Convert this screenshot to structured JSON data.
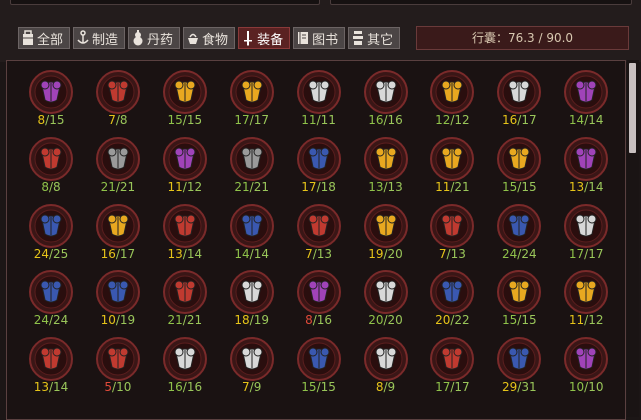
{
  "tabs": [
    {
      "label": "全部",
      "icon": "bag-icon",
      "active": false
    },
    {
      "label": "制造",
      "icon": "anvil-icon",
      "active": false
    },
    {
      "label": "丹药",
      "icon": "gourd-icon",
      "active": false
    },
    {
      "label": "食物",
      "icon": "food-icon",
      "active": false
    },
    {
      "label": "装备",
      "icon": "sword-icon",
      "active": true
    },
    {
      "label": "图书",
      "icon": "book-icon",
      "active": false
    },
    {
      "label": "其它",
      "icon": "misc-icon",
      "active": false
    }
  ],
  "capacity": "行囊：76.3 / 90.0",
  "colors": {
    "purple": "#a043b8",
    "red": "#c03a30",
    "gold": "#e8a820",
    "white": "#d8d8d8",
    "gray": "#9a9a9a",
    "blue": "#3a58b0"
  },
  "items": [
    {
      "cur": "8",
      "max": "15",
      "color": "purple",
      "state": "low"
    },
    {
      "cur": "7",
      "max": "8",
      "color": "red",
      "state": "low"
    },
    {
      "cur": "15",
      "max": "15",
      "color": "gold",
      "state": "ok"
    },
    {
      "cur": "17",
      "max": "17",
      "color": "gold",
      "state": "ok"
    },
    {
      "cur": "11",
      "max": "11",
      "color": "white",
      "state": "ok"
    },
    {
      "cur": "16",
      "max": "16",
      "color": "white",
      "state": "ok"
    },
    {
      "cur": "12",
      "max": "12",
      "color": "gold",
      "state": "ok"
    },
    {
      "cur": "16",
      "max": "17",
      "color": "white",
      "state": "low"
    },
    {
      "cur": "14",
      "max": "14",
      "color": "purple",
      "state": "ok"
    },
    {
      "cur": "8",
      "max": "8",
      "color": "red",
      "state": "ok"
    },
    {
      "cur": "21",
      "max": "21",
      "color": "gray",
      "state": "ok"
    },
    {
      "cur": "11",
      "max": "12",
      "color": "purple",
      "state": "low"
    },
    {
      "cur": "21",
      "max": "21",
      "color": "gray",
      "state": "ok"
    },
    {
      "cur": "17",
      "max": "18",
      "color": "blue",
      "state": "low"
    },
    {
      "cur": "13",
      "max": "13",
      "color": "gold",
      "state": "ok"
    },
    {
      "cur": "11",
      "max": "21",
      "color": "gold",
      "state": "low"
    },
    {
      "cur": "15",
      "max": "15",
      "color": "gold",
      "state": "ok"
    },
    {
      "cur": "13",
      "max": "14",
      "color": "purple",
      "state": "low"
    },
    {
      "cur": "24",
      "max": "25",
      "color": "blue",
      "state": "low"
    },
    {
      "cur": "16",
      "max": "17",
      "color": "gold",
      "state": "low"
    },
    {
      "cur": "13",
      "max": "14",
      "color": "red",
      "state": "low"
    },
    {
      "cur": "14",
      "max": "14",
      "color": "blue",
      "state": "ok"
    },
    {
      "cur": "7",
      "max": "13",
      "color": "red",
      "state": "low"
    },
    {
      "cur": "19",
      "max": "20",
      "color": "gold",
      "state": "low"
    },
    {
      "cur": "7",
      "max": "13",
      "color": "red",
      "state": "low"
    },
    {
      "cur": "24",
      "max": "24",
      "color": "blue",
      "state": "ok"
    },
    {
      "cur": "17",
      "max": "17",
      "color": "white",
      "state": "ok"
    },
    {
      "cur": "24",
      "max": "24",
      "color": "blue",
      "state": "ok"
    },
    {
      "cur": "10",
      "max": "19",
      "color": "blue",
      "state": "low"
    },
    {
      "cur": "21",
      "max": "21",
      "color": "red",
      "state": "ok"
    },
    {
      "cur": "18",
      "max": "19",
      "color": "white",
      "state": "low"
    },
    {
      "cur": "8",
      "max": "16",
      "color": "purple",
      "state": "crit"
    },
    {
      "cur": "20",
      "max": "20",
      "color": "white",
      "state": "ok"
    },
    {
      "cur": "20",
      "max": "22",
      "color": "blue",
      "state": "low"
    },
    {
      "cur": "15",
      "max": "15",
      "color": "gold",
      "state": "ok"
    },
    {
      "cur": "11",
      "max": "12",
      "color": "gold",
      "state": "low"
    },
    {
      "cur": "13",
      "max": "14",
      "color": "red",
      "state": "low"
    },
    {
      "cur": "5",
      "max": "10",
      "color": "red",
      "state": "crit"
    },
    {
      "cur": "16",
      "max": "16",
      "color": "white",
      "state": "ok"
    },
    {
      "cur": "7",
      "max": "9",
      "color": "white",
      "state": "low"
    },
    {
      "cur": "15",
      "max": "15",
      "color": "blue",
      "state": "ok"
    },
    {
      "cur": "8",
      "max": "9",
      "color": "white",
      "state": "low"
    },
    {
      "cur": "17",
      "max": "17",
      "color": "red",
      "state": "ok"
    },
    {
      "cur": "29",
      "max": "31",
      "color": "blue",
      "state": "low"
    },
    {
      "cur": "10",
      "max": "10",
      "color": "purple",
      "state": "ok"
    }
  ]
}
